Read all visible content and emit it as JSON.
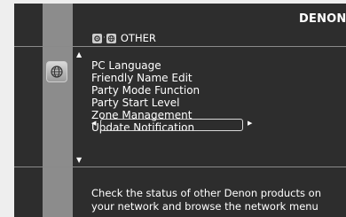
{
  "header": {
    "brand": "DENON",
    "breadcrumb": {
      "icons": [
        "gear-icon",
        "network-icon"
      ],
      "label": "OTHER"
    }
  },
  "sidebar": {
    "active_icon": "globe-network-icon"
  },
  "menu": {
    "items": [
      "PC Language",
      "Friendly Name Edit",
      "Party Mode Function",
      "Party Start Level",
      "Zone Management",
      "Update Notification"
    ],
    "selected_index": 4
  },
  "description": {
    "line1": "Check the status of other Denon products on",
    "line2": "your network and browse the network menu"
  }
}
